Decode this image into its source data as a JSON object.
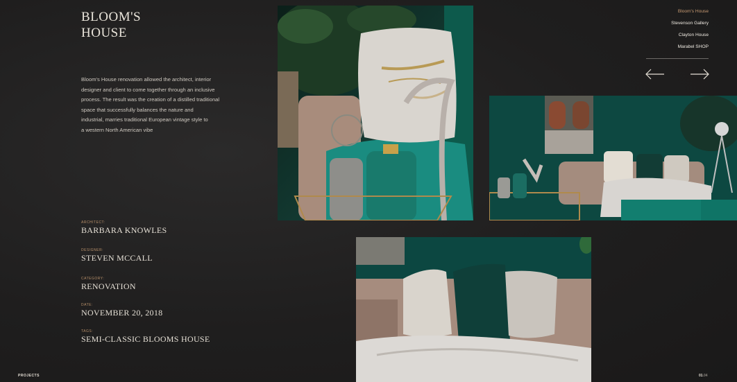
{
  "project": {
    "title_line1": "BLOOM'S",
    "title_line2": "HOUSE",
    "description_lines": [
      "Bloom's House renovation allowed the architect, interior",
      "designer and client to come together through an inclusive",
      "process. The result was the creation of a distilled traditional",
      "space that successfully balances the nature and",
      "industrial, marries traditional European vintage style to",
      "a western  North American vibe"
    ]
  },
  "meta": [
    {
      "label": "ARCHITECT:",
      "value": "BARBARA KNOWLES"
    },
    {
      "label": "DESIGNER:",
      "value": "STEVEN  MCCALL"
    },
    {
      "label": "CATEGORY:",
      "value": "RENOVATION"
    },
    {
      "label": "DATE:",
      "value": "NOVEMBER 20, 2018"
    },
    {
      "label": "TAGS:",
      "value": "SEMI-CLASSIC BLOOMS HOUSE"
    }
  ],
  "nav": {
    "items": [
      "Bloom's House",
      "Stevenson Gallery",
      "Clayton House",
      "Marabel SHOP"
    ],
    "active_index": 0,
    "prev_icon": "arrow-left-icon",
    "next_icon": "arrow-right-icon"
  },
  "footer": {
    "section": "PROJECTS",
    "page_current": "01",
    "page_total": "04",
    "separator": "."
  },
  "colors": {
    "background": "#1f1e1e",
    "accent": "#c89b73",
    "teal": "#0e4a42",
    "text": "#e6e0d6"
  }
}
